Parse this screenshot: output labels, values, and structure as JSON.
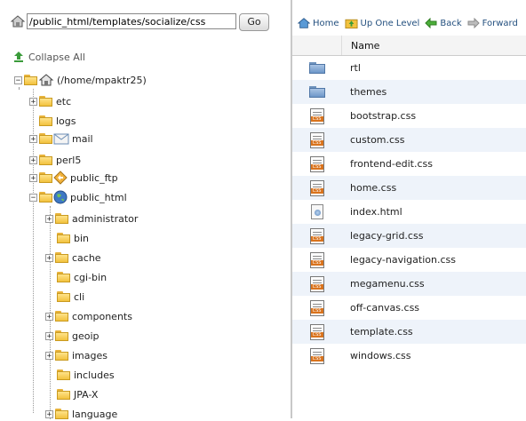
{
  "path": {
    "value": "/public_html/templates/socialize/css",
    "go_label": "Go"
  },
  "collapse_all": "Collapse All",
  "tree": {
    "root": "(/home/mpaktr25)",
    "items": [
      "etc",
      "logs",
      "mail",
      "perl5",
      "public_ftp",
      "public_html"
    ],
    "children": [
      "administrator",
      "bin",
      "cache",
      "cgi-bin",
      "cli",
      "components",
      "geoip",
      "images",
      "includes",
      "JPA-X",
      "language"
    ]
  },
  "toolbar": {
    "home": "Home",
    "up": "Up One Level",
    "back": "Back",
    "forward": "Forward"
  },
  "table": {
    "header": "Name",
    "rows": [
      {
        "name": "rtl",
        "type": "folder"
      },
      {
        "name": "themes",
        "type": "folder"
      },
      {
        "name": "bootstrap.css",
        "type": "css"
      },
      {
        "name": "custom.css",
        "type": "css"
      },
      {
        "name": "frontend-edit.css",
        "type": "css"
      },
      {
        "name": "home.css",
        "type": "css"
      },
      {
        "name": "index.html",
        "type": "html"
      },
      {
        "name": "legacy-grid.css",
        "type": "css"
      },
      {
        "name": "legacy-navigation.css",
        "type": "css"
      },
      {
        "name": "megamenu.css",
        "type": "css"
      },
      {
        "name": "off-canvas.css",
        "type": "css"
      },
      {
        "name": "template.css",
        "type": "css"
      },
      {
        "name": "windows.css",
        "type": "css"
      }
    ]
  },
  "icons": {
    "folder_yellow": "folder-icon",
    "folder_blue": "folder-icon",
    "css": "css-file-icon",
    "html": "html-file-icon",
    "home": "home-icon",
    "mail": "mail-icon",
    "ftp": "ftp-icon",
    "globe": "globe-icon"
  }
}
